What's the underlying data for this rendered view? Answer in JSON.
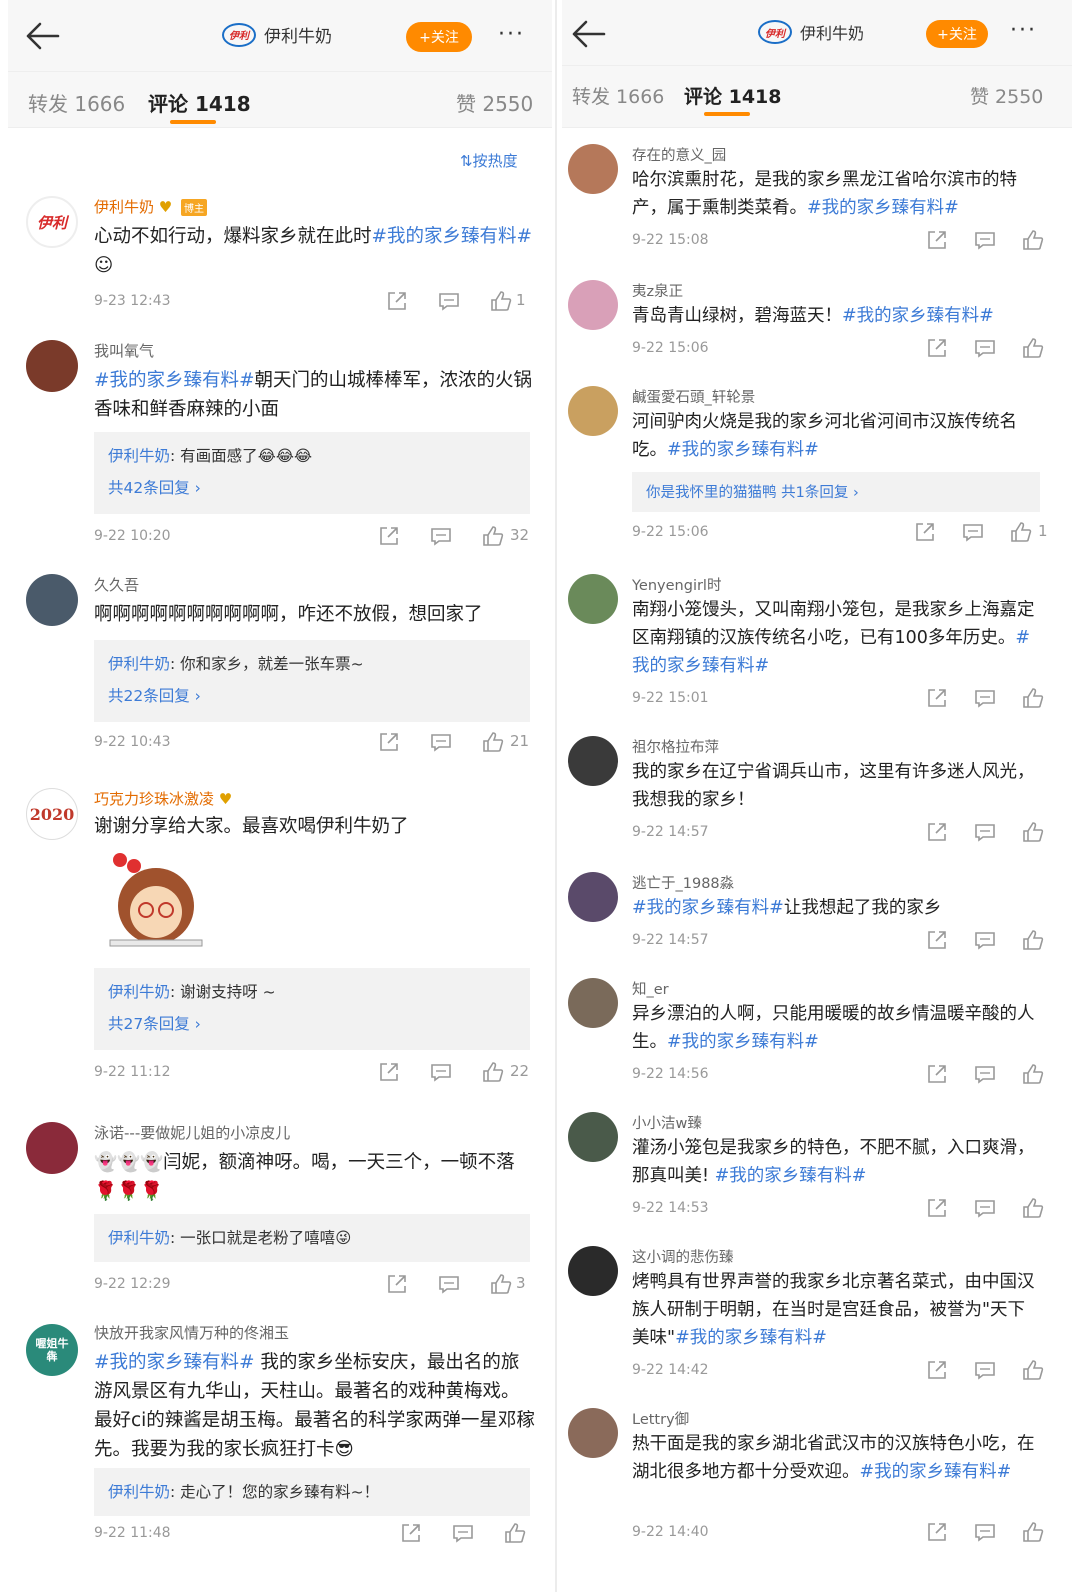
{
  "left": {
    "brand_name": "伊利牛奶",
    "logo_text": "伊利",
    "follow_label": "+关注",
    "more_label": "···",
    "tabs": {
      "repost": "转发 1666",
      "comments": "评论 1418",
      "likes": "赞 2550"
    },
    "sort_label": "按热度",
    "comments": [
      {
        "user": "伊利牛奶",
        "badge": "博主",
        "text_a": "心动不如行动，爆料家乡就在此时",
        "tag_a": "#我的家乡臻有料#",
        "time": "9-23 12:43",
        "likes": "1"
      },
      {
        "user": "我叫氧气",
        "tag_a": "#我的家乡臻有料#",
        "text_a": "朝天门的山城棒棒军，浓浓的火锅香味和鲜香麻辣的小面",
        "reply_user": "伊利牛奶",
        "reply_text": ": 有画面感了😂😂😂",
        "reply_more": "共42条回复 ›",
        "time": "9-22 10:20",
        "likes": "32"
      },
      {
        "user": "久久吾",
        "text_a": "啊啊啊啊啊啊啊啊啊啊，咋还不放假，想回家了",
        "reply_user": "伊利牛奶",
        "reply_text": ": 你和家乡，就差一张车票~",
        "reply_more": "共22条回复 ›",
        "time": "9-22 10:43",
        "likes": "21"
      },
      {
        "user": "巧克力珍珠冰激凌",
        "avatar_text": "2020",
        "text_a": "谢谢分享给大家。最喜欢喝伊利牛奶了",
        "reply_user": "伊利牛奶",
        "reply_text": ": 谢谢支持呀 ~",
        "reply_more": "共27条回复 ›",
        "time": "9-22 11:12",
        "likes": "22"
      },
      {
        "user": "泳诺---要做妮儿姐的小凉皮儿",
        "text_a": "👻👻👻闫妮，额滴神呀。喝，一天三个，一顿不落🌹🌹🌹",
        "reply_user": "伊利牛奶",
        "reply_text": ": 一张口就是老粉了嘻嘻😜",
        "time": "9-22 12:29",
        "likes": "3"
      },
      {
        "user": "快放开我家风情万种的佟湘玉",
        "avatar_text": "喔姐牛犇",
        "tag_a": "#我的家乡臻有料#",
        "text_a": " 我的家乡坐标安庆，最出名的旅游风景区有九华山，天柱山。最著名的戏种黄梅戏。最好ci的辣酱是胡玉梅。最著名的科学家两弹一星邓稼先。我要为我的家长疯狂打卡😎",
        "reply_user": "伊利牛奶",
        "reply_text": ": 走心了！您的家乡臻有料~！",
        "time": "9-22 11:48",
        "likes": ""
      }
    ]
  },
  "right": {
    "brand_name": "伊利牛奶",
    "logo_text": "伊利",
    "follow_label": "+关注",
    "more_label": "···",
    "tabs": {
      "repost": "转发 1666",
      "comments": "评论 1418",
      "likes": "赞 2550"
    },
    "comments": [
      {
        "user": "存在的意义_园",
        "text_a": "哈尔滨熏肘花，是我的家乡黑龙江省哈尔滨市的特产，属于熏制类菜肴。",
        "tag_a": "#我的家乡臻有料#",
        "time": "9-22 15:08"
      },
      {
        "user": "夷z泉正",
        "text_a": "青岛青山绿树，碧海蓝天！",
        "tag_a": "#我的家乡臻有料#",
        "time": "9-22 15:06"
      },
      {
        "user": "鹹蛋愛石頭_轩轮景",
        "text_a": "河间驴肉火烧是我的家乡河北省河间市汉族传统名吃。",
        "tag_a": "#我的家乡臻有料#",
        "reply_more": "你是我怀里的猫猫鸭  共1条回复 ›",
        "time": "9-22 15:06",
        "likes": "1"
      },
      {
        "user": "Yenyengirl时",
        "text_a": "南翔小笼馒头，又叫南翔小笼包，是我家乡上海嘉定区南翔镇的汉族传统名小吃，已有100多年历史。",
        "tag_a": "#我的家乡臻有料#",
        "time": "9-22 15:01"
      },
      {
        "user": "祖尔格拉布萍",
        "text_a": "我的家乡在辽宁省调兵山市，这里有许多迷人风光，我想我的家乡！",
        "time": "9-22 14:57"
      },
      {
        "user": "逃亡于_1988淼",
        "tag_a": "#我的家乡臻有料#",
        "text_a": "让我想起了我的家乡",
        "time": "9-22 14:57"
      },
      {
        "user": "知_er",
        "text_a": "异乡漂泊的人啊，只能用暖暖的故乡情温暖辛酸的人生。",
        "tag_a": "#我的家乡臻有料#",
        "time": "9-22 14:56"
      },
      {
        "user": "小小洁w臻",
        "text_a": "灌汤小笼包是我家乡的特色，不肥不腻，入口爽滑，那真叫美! ",
        "tag_a": "#我的家乡臻有料#",
        "time": "9-22 14:53"
      },
      {
        "user": "这小调的悲伤臻",
        "text_a": "烤鸭具有世界声誉的我家乡北京著名菜式，由中国汉族人研制于明朝，在当时是宫廷食品，被誉为\"天下美味\"",
        "tag_a": "#我的家乡臻有料#",
        "time": "9-22 14:42"
      },
      {
        "user": "Lettry御",
        "text_a": "热干面是我的家乡湖北省武汉市的汉族特色小吃，在湖北很多地方都十分受欢迎。",
        "tag_a": "#我的家乡臻有料#",
        "time": "9-22 14:40"
      }
    ]
  },
  "colors": {
    "accent": "#ff8a00",
    "link": "#3d7bd6",
    "username_official": "#e36b00"
  }
}
